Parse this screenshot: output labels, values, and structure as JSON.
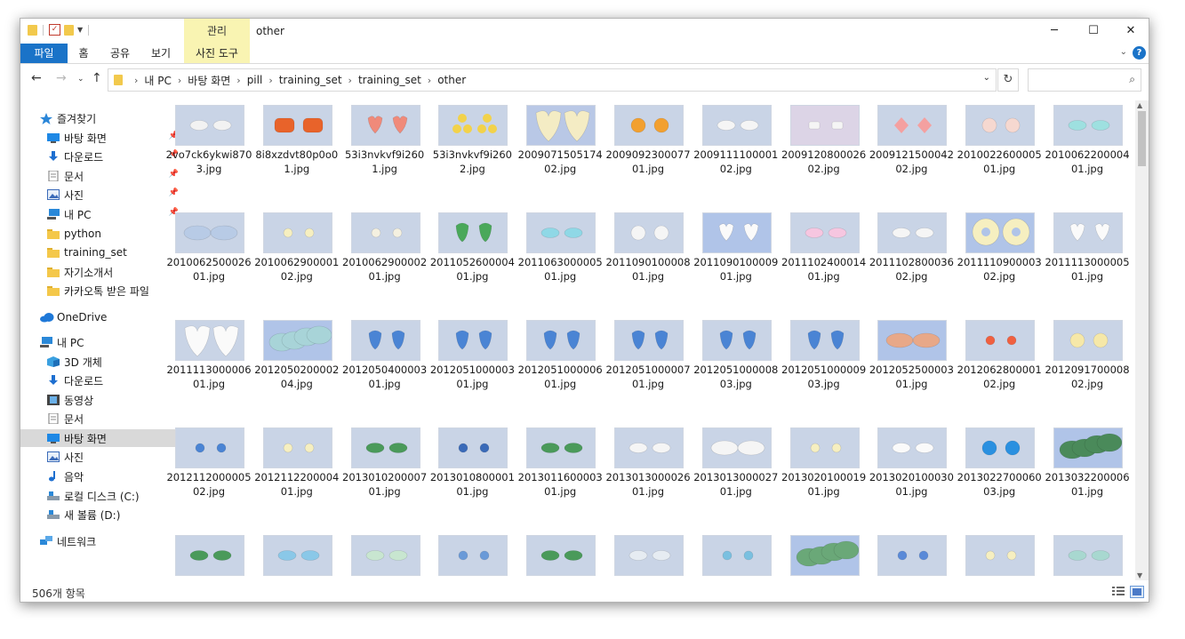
{
  "window": {
    "title": "other",
    "context_tab": "관리",
    "controls": {
      "minimize": "─",
      "maximize": "☐",
      "close": "✕"
    }
  },
  "ribbon": {
    "tabs": [
      {
        "label": "파일",
        "kind": "file"
      },
      {
        "label": "홈",
        "kind": "normal"
      },
      {
        "label": "공유",
        "kind": "normal"
      },
      {
        "label": "보기",
        "kind": "normal"
      },
      {
        "label": "사진 도구",
        "kind": "ctx"
      }
    ],
    "help": "?"
  },
  "address": {
    "crumbs": [
      "내 PC",
      "바탕 화면",
      "pill",
      "training_set",
      "training_set",
      "other"
    ],
    "search_placeholder": ""
  },
  "nav": {
    "items": [
      {
        "label": "즐겨찾기",
        "icon": "star-icon",
        "indent": 1,
        "pinned": false
      },
      {
        "label": "바탕 화면",
        "icon": "desktop-icon",
        "indent": 2,
        "pinned": true
      },
      {
        "label": "다운로드",
        "icon": "download-icon",
        "indent": 2,
        "pinned": true
      },
      {
        "label": "문서",
        "icon": "document-icon",
        "indent": 2,
        "pinned": true
      },
      {
        "label": "사진",
        "icon": "picture-icon",
        "indent": 2,
        "pinned": true
      },
      {
        "label": "내 PC",
        "icon": "computer-icon",
        "indent": 2,
        "pinned": true
      },
      {
        "label": "python",
        "icon": "folder-icon",
        "indent": 2,
        "pinned": false
      },
      {
        "label": "training_set",
        "icon": "folder-icon",
        "indent": 2,
        "pinned": false
      },
      {
        "label": "자기소개서",
        "icon": "folder-icon",
        "indent": 2,
        "pinned": false
      },
      {
        "label": "카카오톡 받은 파일",
        "icon": "folder-icon",
        "indent": 2,
        "pinned": false
      },
      {
        "label": "OneDrive",
        "icon": "cloud-icon",
        "indent": 1,
        "pinned": false
      },
      {
        "label": "내 PC",
        "icon": "computer-icon",
        "indent": 1,
        "pinned": false
      },
      {
        "label": "3D 개체",
        "icon": "cube-icon",
        "indent": 2,
        "pinned": false
      },
      {
        "label": "다운로드",
        "icon": "download-icon",
        "indent": 2,
        "pinned": false
      },
      {
        "label": "동영상",
        "icon": "video-icon",
        "indent": 2,
        "pinned": false
      },
      {
        "label": "문서",
        "icon": "document-icon",
        "indent": 2,
        "pinned": false
      },
      {
        "label": "바탕 화면",
        "icon": "desktop-icon",
        "indent": 2,
        "pinned": false,
        "selected": true
      },
      {
        "label": "사진",
        "icon": "picture-icon",
        "indent": 2,
        "pinned": false
      },
      {
        "label": "음악",
        "icon": "music-icon",
        "indent": 2,
        "pinned": false
      },
      {
        "label": "로컬 디스크 (C:)",
        "icon": "drive-icon",
        "indent": 2,
        "pinned": false
      },
      {
        "label": "새 볼륨 (D:)",
        "icon": "drive-icon",
        "indent": 2,
        "pinned": false
      },
      {
        "label": "네트워크",
        "icon": "network-icon",
        "indent": 1,
        "pinned": false
      }
    ]
  },
  "files": [
    {
      "name": "2vo7ck6ykwi8703.jpg",
      "bg": "#c9d4e6",
      "pill": "#f2f2f2",
      "shape": "oval"
    },
    {
      "name": "8i8xzdvt80p0o01.jpg",
      "bg": "#c9d4e6",
      "pill": "#e8632a",
      "shape": "rect"
    },
    {
      "name": "53i3nvkvf9i2601.jpg",
      "bg": "#c9d4e6",
      "pill": "#f08a7a",
      "shape": "heart"
    },
    {
      "name": "53i3nvkvf9i2602.jpg",
      "bg": "#c9d4e6",
      "pill": "#f2d24a",
      "shape": "tri"
    },
    {
      "name": "200907150517402.jpg",
      "bg": "#b9c8e6",
      "pill": "#f4ecc4",
      "shape": "heart-big"
    },
    {
      "name": "200909230007701.jpg",
      "bg": "#c9d4e6",
      "pill": "#f2a030",
      "shape": "round"
    },
    {
      "name": "200911110000102.jpg",
      "bg": "#c9d4e6",
      "pill": "#f5f5f5",
      "shape": "oval"
    },
    {
      "name": "200912080002602.jpg",
      "bg": "#dcd4e6",
      "pill": "#f5f5f5",
      "shape": "rect-small"
    },
    {
      "name": "200912150004202.jpg",
      "bg": "#c9d4e6",
      "pill": "#f4a0a0",
      "shape": "diamond"
    },
    {
      "name": "201002260000501.jpg",
      "bg": "#c9d4e6",
      "pill": "#f6d8d0",
      "shape": "round"
    },
    {
      "name": "201006220000401.jpg",
      "bg": "#c9d4e6",
      "pill": "#9ee0e0",
      "shape": "oval"
    },
    {
      "name": "201006250002601.jpg",
      "bg": "#c9d4e6",
      "pill": "#b8cbe6",
      "shape": "oval-big"
    },
    {
      "name": "201006290000102.jpg",
      "bg": "#c9d4e6",
      "pill": "#f6efc0",
      "shape": "round-small"
    },
    {
      "name": "201006290000201.jpg",
      "bg": "#c9d4e6",
      "pill": "#f4f0e0",
      "shape": "round-small"
    },
    {
      "name": "201105260000401.jpg",
      "bg": "#c9d4e6",
      "pill": "#4aa85a",
      "shape": "drop"
    },
    {
      "name": "201106300000501.jpg",
      "bg": "#c9d4e6",
      "pill": "#8fd8e6",
      "shape": "oval"
    },
    {
      "name": "201109010000801.jpg",
      "bg": "#c9d4e6",
      "pill": "#f5f5f5",
      "shape": "round"
    },
    {
      "name": "201109010000901.jpg",
      "bg": "#b0c4e8",
      "pill": "#fafafa",
      "shape": "heart"
    },
    {
      "name": "201110240001401.jpg",
      "bg": "#c9d4e6",
      "pill": "#f6c6e0",
      "shape": "oval"
    },
    {
      "name": "201110280003602.jpg",
      "bg": "#c9d4e6",
      "pill": "#f5f5f5",
      "shape": "oval"
    },
    {
      "name": "201111090000302.jpg",
      "bg": "#b0c4e8",
      "pill": "#f6efc0",
      "shape": "ring"
    },
    {
      "name": "201111300000501.jpg",
      "bg": "#c9d4e6",
      "pill": "#fafafa",
      "shape": "heart"
    },
    {
      "name": "201111300000601.jpg",
      "bg": "#c9d4e6",
      "pill": "#fafafa",
      "shape": "heart-big"
    },
    {
      "name": "201205020000204.jpg",
      "bg": "#b0c4e8",
      "pill": "#a8d4d8",
      "shape": "double"
    },
    {
      "name": "201205040000301.jpg",
      "bg": "#c9d4e6",
      "pill": "#4a84d4",
      "shape": "drop"
    },
    {
      "name": "201205100000301.jpg",
      "bg": "#c9d4e6",
      "pill": "#4a84d4",
      "shape": "drop"
    },
    {
      "name": "201205100000601.jpg",
      "bg": "#c9d4e6",
      "pill": "#4a84d4",
      "shape": "drop"
    },
    {
      "name": "201205100000701.jpg",
      "bg": "#c9d4e6",
      "pill": "#4a84d4",
      "shape": "drop"
    },
    {
      "name": "201205100000803.jpg",
      "bg": "#c9d4e6",
      "pill": "#4a84d4",
      "shape": "drop"
    },
    {
      "name": "201205100000903.jpg",
      "bg": "#c9d4e6",
      "pill": "#4a84d4",
      "shape": "drop"
    },
    {
      "name": "201205250000301.jpg",
      "bg": "#b0c4e8",
      "pill": "#e8a888",
      "shape": "oval-big"
    },
    {
      "name": "201206280000102.jpg",
      "bg": "#c9d4e6",
      "pill": "#f06040",
      "shape": "round-small"
    },
    {
      "name": "201209170000802.jpg",
      "bg": "#c9d4e6",
      "pill": "#f6e8a8",
      "shape": "round"
    },
    {
      "name": "201211200000502.jpg",
      "bg": "#c9d4e6",
      "pill": "#4a84d4",
      "shape": "round-small"
    },
    {
      "name": "201211220000401.jpg",
      "bg": "#c9d4e6",
      "pill": "#f6efc0",
      "shape": "round-small"
    },
    {
      "name": "201301020000701.jpg",
      "bg": "#c9d4e6",
      "pill": "#4a9a5a",
      "shape": "oval"
    },
    {
      "name": "201301080000101.jpg",
      "bg": "#c9d4e6",
      "pill": "#3a6ab8",
      "shape": "round-small"
    },
    {
      "name": "201301160000301.jpg",
      "bg": "#c9d4e6",
      "pill": "#4a9a5a",
      "shape": "oval"
    },
    {
      "name": "201301300002601.jpg",
      "bg": "#c9d4e6",
      "pill": "#f5f5f5",
      "shape": "oval"
    },
    {
      "name": "201301300002701.jpg",
      "bg": "#c9d4e6",
      "pill": "#f5f5f5",
      "shape": "oval-big"
    },
    {
      "name": "201302010001901.jpg",
      "bg": "#c9d4e6",
      "pill": "#f6efc0",
      "shape": "round-small"
    },
    {
      "name": "201302010003001.jpg",
      "bg": "#c9d4e6",
      "pill": "#fafafa",
      "shape": "oval"
    },
    {
      "name": "201302270006003.jpg",
      "bg": "#c9d4e6",
      "pill": "#2a90e0",
      "shape": "round"
    },
    {
      "name": "201303220000601.jpg",
      "bg": "#b0c4e8",
      "pill": "#4a8a5a",
      "shape": "double"
    },
    {
      "name": "",
      "bg": "#c9d4e6",
      "pill": "#4a9a5a",
      "shape": "oval"
    },
    {
      "name": "",
      "bg": "#c9d4e6",
      "pill": "#8ac8e8",
      "shape": "oval"
    },
    {
      "name": "",
      "bg": "#c9d4e6",
      "pill": "#c8e6d0",
      "shape": "oval"
    },
    {
      "name": "",
      "bg": "#c9d4e6",
      "pill": "#6a9ad8",
      "shape": "round-small"
    },
    {
      "name": "",
      "bg": "#c9d4e6",
      "pill": "#4a9a5a",
      "shape": "oval"
    },
    {
      "name": "",
      "bg": "#c9d4e6",
      "pill": "#e6ecf2",
      "shape": "oval"
    },
    {
      "name": "",
      "bg": "#c9d4e6",
      "pill": "#7ac0e0",
      "shape": "round-small"
    },
    {
      "name": "",
      "bg": "#b0c4e8",
      "pill": "#6aa878",
      "shape": "double"
    },
    {
      "name": "",
      "bg": "#c9d4e6",
      "pill": "#5a8ad8",
      "shape": "round-small"
    },
    {
      "name": "",
      "bg": "#c9d4e6",
      "pill": "#f6efc0",
      "shape": "round-small"
    },
    {
      "name": "",
      "bg": "#c9d4e6",
      "pill": "#a8d8d0",
      "shape": "oval"
    }
  ],
  "status": {
    "item_count": "506개 항목"
  }
}
